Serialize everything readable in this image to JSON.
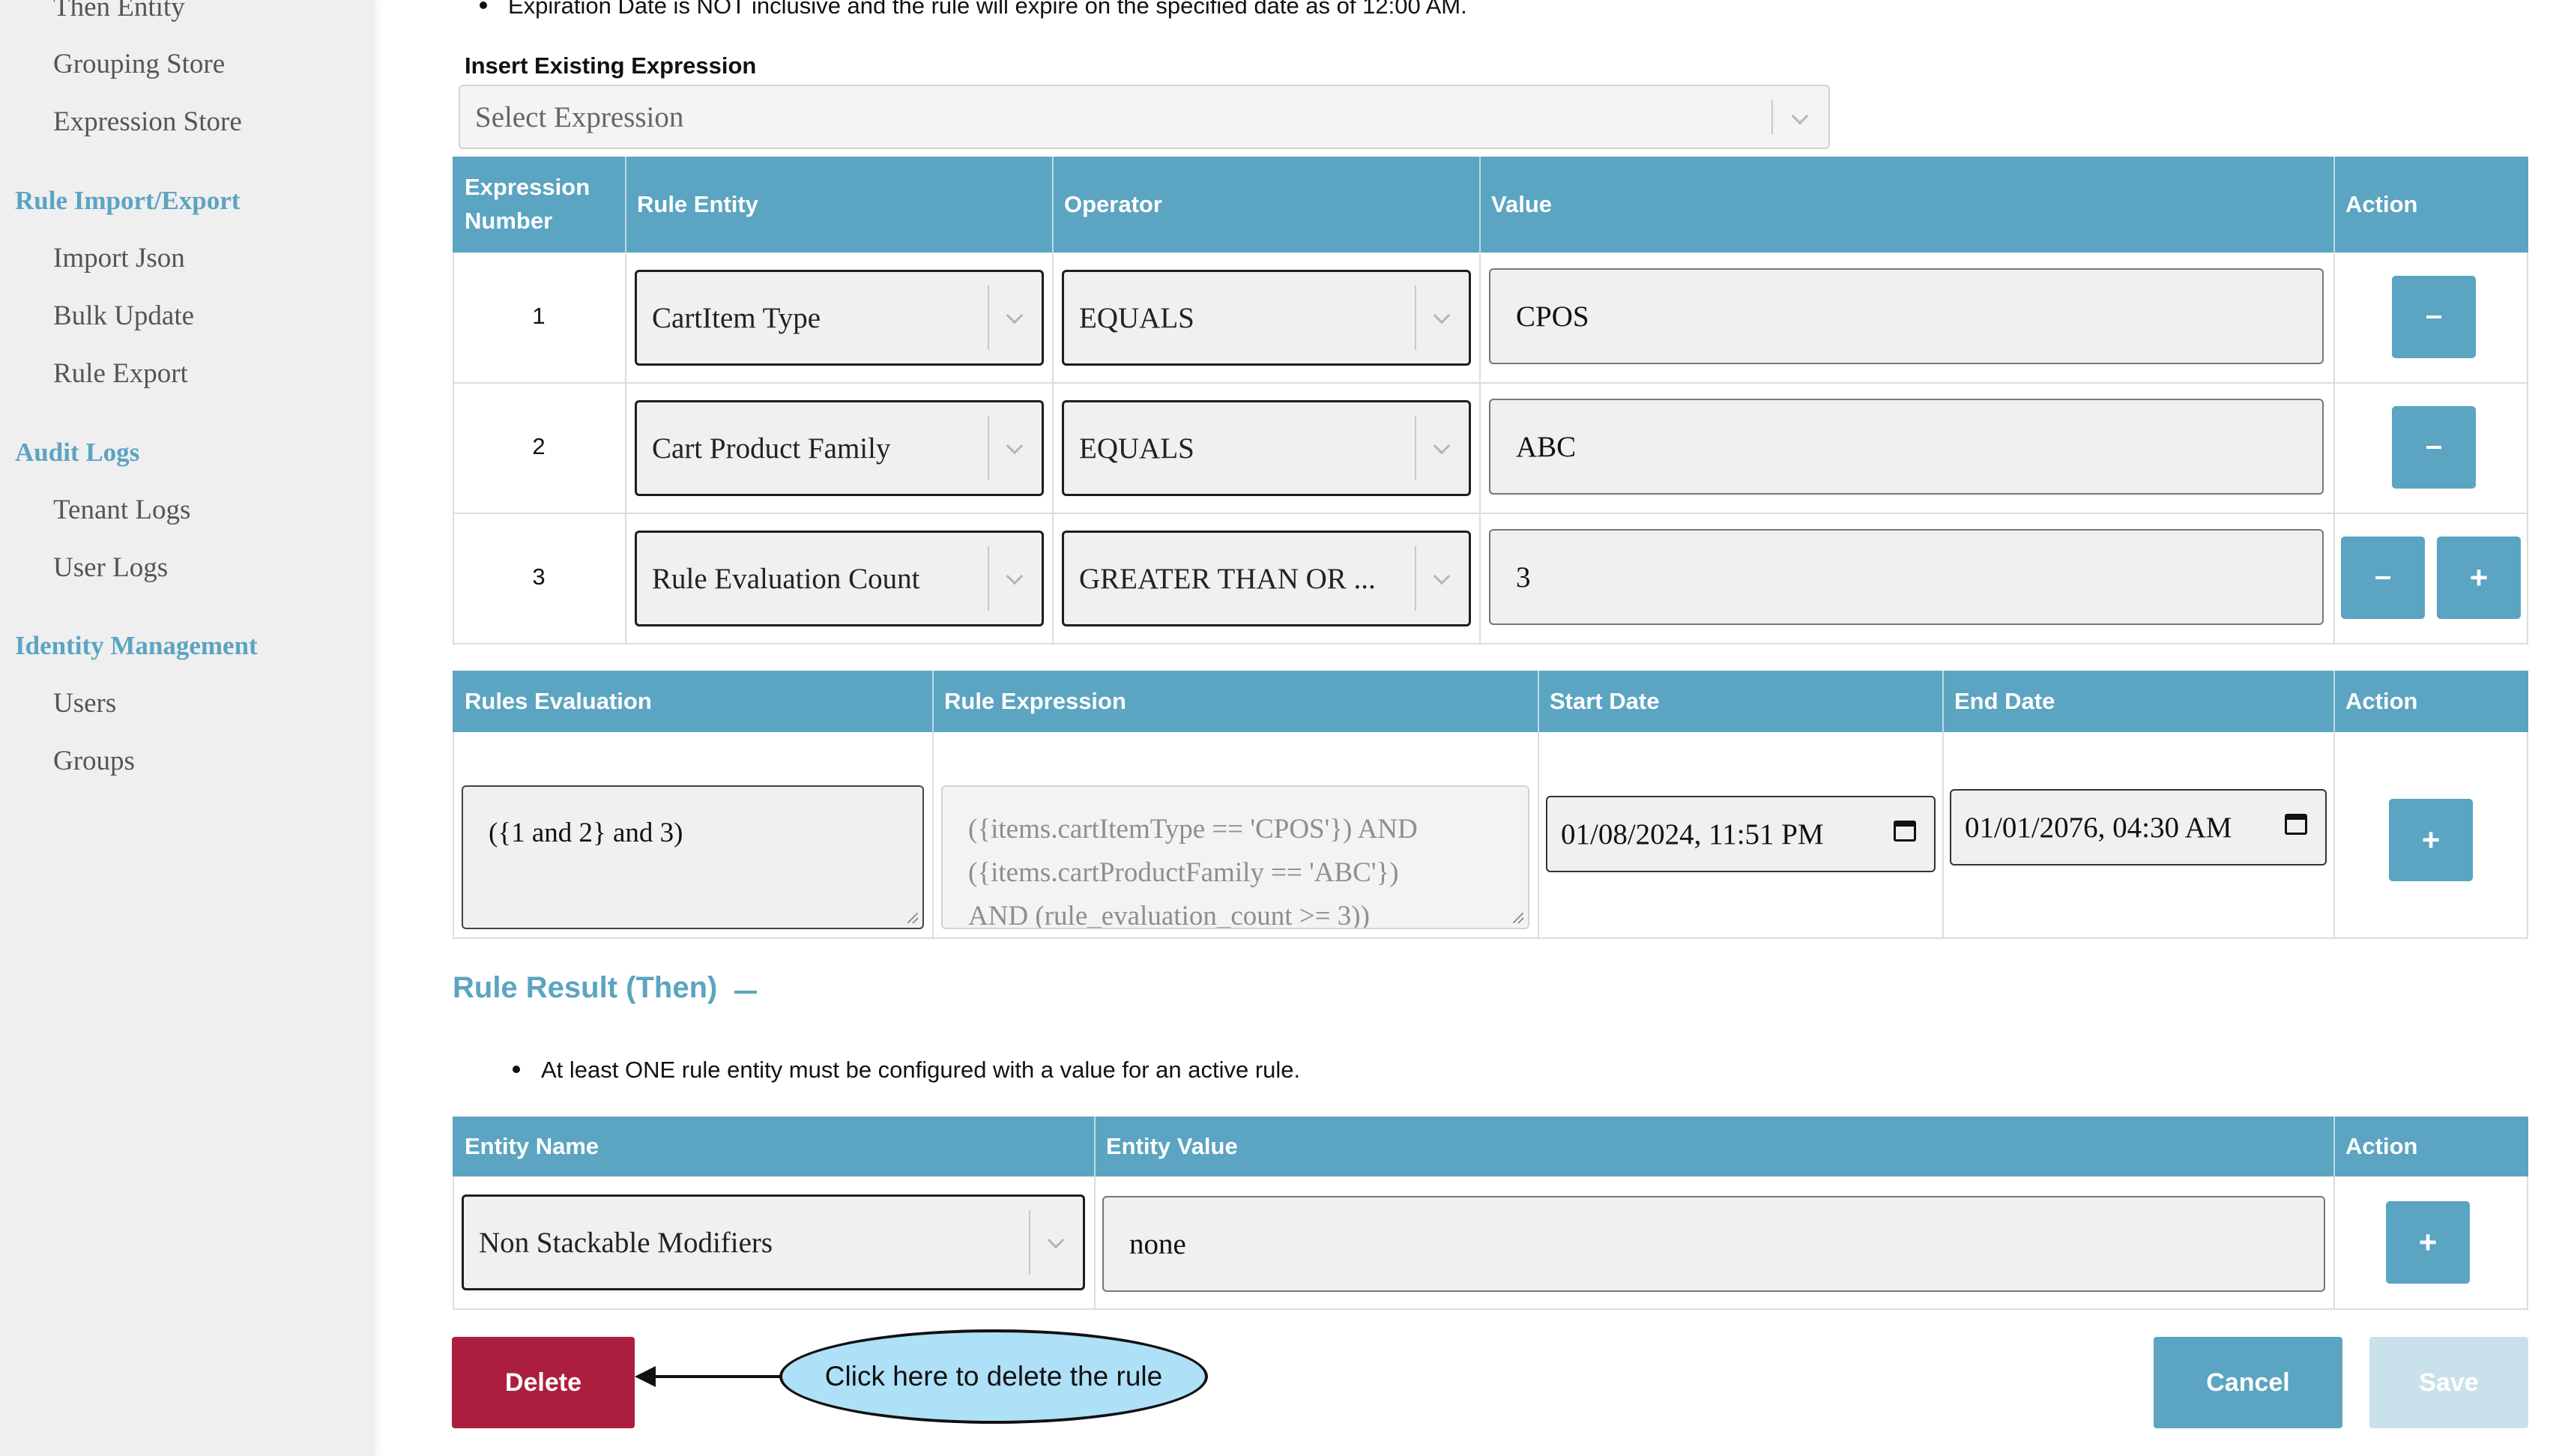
{
  "sidebar": {
    "items": [
      {
        "label": "Then Entity",
        "type": "item"
      },
      {
        "label": "Grouping Store",
        "type": "item"
      },
      {
        "label": "Expression Store",
        "type": "item"
      },
      {
        "label": "Rule Import/Export",
        "type": "heading"
      },
      {
        "label": "Import Json",
        "type": "item"
      },
      {
        "label": "Bulk Update",
        "type": "item"
      },
      {
        "label": "Rule Export",
        "type": "item"
      },
      {
        "label": "Audit Logs",
        "type": "heading"
      },
      {
        "label": "Tenant Logs",
        "type": "item"
      },
      {
        "label": "User Logs",
        "type": "item"
      },
      {
        "label": "Identity Management",
        "type": "heading"
      },
      {
        "label": "Users",
        "type": "item"
      },
      {
        "label": "Groups",
        "type": "item"
      }
    ]
  },
  "top_note": "Expiration Date is NOT inclusive and the rule will expire on the specified date as of 12:00 AM.",
  "insert_expression": {
    "label": "Insert Existing Expression",
    "placeholder": "Select Expression"
  },
  "expressions_table": {
    "headers": {
      "number": "Expression Number",
      "entity": "Rule Entity",
      "operator": "Operator",
      "value": "Value",
      "action": "Action"
    },
    "rows": [
      {
        "number": "1",
        "entity": "CartItem Type",
        "operator": "EQUALS",
        "value": "CPOS"
      },
      {
        "number": "2",
        "entity": "Cart Product Family",
        "operator": "EQUALS",
        "value": "ABC"
      },
      {
        "number": "3",
        "entity": "Rule Evaluation Count",
        "operator": "GREATER THAN OR ...",
        "value": "3"
      }
    ]
  },
  "evaluation_table": {
    "headers": {
      "evaluation": "Rules Evaluation",
      "expression": "Rule Expression",
      "start": "Start Date",
      "end": "End Date",
      "action": "Action"
    },
    "evaluation_value": "({1 and 2} and 3)",
    "expression_lines": [
      "({items.cartItemType == 'CPOS'})  AND",
      "({items.cartProductFamily == 'ABC'})",
      "AND (rule_evaluation_count >= 3))"
    ],
    "start_date": "01/08/2024, 11:51  PM",
    "end_date": "01/01/2076, 04:30  AM"
  },
  "rule_result": {
    "title": "Rule Result (Then)",
    "note": "At least ONE rule entity must be configured with a value for an active rule.",
    "headers": {
      "name": "Entity Name",
      "value": "Entity Value",
      "action": "Action"
    },
    "entity_name": "Non Stackable Modifiers",
    "entity_value": "none"
  },
  "buttons": {
    "delete": "Delete",
    "cancel": "Cancel",
    "save": "Save",
    "plus": "+"
  },
  "callout": "Click here to delete the rule",
  "colors": {
    "accent": "#5ba4c2",
    "delete": "#ac1e3e",
    "save_disabled": "#c9e1eb",
    "callout": "#aee0f8"
  }
}
